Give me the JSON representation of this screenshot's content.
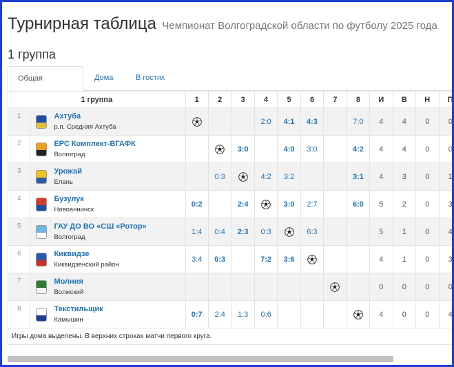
{
  "header": {
    "title": "Турнирная таблица",
    "subtitle": "Чемпионат Волгоградской области по футболу 2025 года"
  },
  "group_heading": "1 группа",
  "tabs": [
    {
      "label": "Общая таблица",
      "active": true
    },
    {
      "label": "Дома",
      "active": false
    },
    {
      "label": "В гостях",
      "active": false
    }
  ],
  "columns": {
    "group": "1 группа",
    "matches": [
      "1",
      "2",
      "3",
      "4",
      "5",
      "6",
      "7",
      "8"
    ],
    "stats": [
      "И",
      "В",
      "Н",
      "П"
    ]
  },
  "rows": [
    {
      "pos": "1",
      "name": "Ахтуба",
      "city": "р.п. Средняя Ахтуба",
      "logo_colors": [
        "#1d4fa8",
        "#e0c040"
      ],
      "results": [
        "ball",
        "",
        "",
        "2:0",
        "4:1",
        "4:3",
        "",
        "7:0"
      ],
      "home": [
        false,
        false,
        false,
        false,
        true,
        true,
        false,
        false
      ],
      "stats": [
        "4",
        "4",
        "0",
        "0"
      ]
    },
    {
      "pos": "2",
      "name": "ЕРС Комплект-ВГАФК",
      "city": "Волгоград",
      "logo_colors": [
        "#f0a020",
        "#222222"
      ],
      "results": [
        "",
        "ball",
        "3:0",
        "",
        "4:0",
        "3:0",
        "",
        "4:2"
      ],
      "home": [
        false,
        false,
        true,
        false,
        true,
        false,
        false,
        true
      ],
      "stats": [
        "4",
        "4",
        "0",
        "0"
      ]
    },
    {
      "pos": "3",
      "name": "Урожай",
      "city": "Елань",
      "logo_colors": [
        "#f3c41b",
        "#2a5db0"
      ],
      "results": [
        "",
        "0:3",
        "ball",
        "4:2",
        "3:2",
        "",
        "",
        "3:1"
      ],
      "home": [
        false,
        false,
        false,
        false,
        false,
        false,
        false,
        true
      ],
      "stats": [
        "4",
        "3",
        "0",
        "1"
      ]
    },
    {
      "pos": "4",
      "name": "Бузулук",
      "city": "Новоаннинск",
      "logo_colors": [
        "#d63a2f",
        "#1f4fa0"
      ],
      "results": [
        "0:2",
        "",
        "2:4",
        "ball",
        "3:0",
        "2:7",
        "",
        "6:0"
      ],
      "home": [
        true,
        false,
        true,
        false,
        true,
        false,
        false,
        true
      ],
      "stats": [
        "5",
        "2",
        "0",
        "3"
      ]
    },
    {
      "pos": "5",
      "name": "ГАУ ДО ВО «СШ «Ротор»",
      "city": "Волгоград",
      "logo_colors": [
        "#6fb7e6",
        "#ffffff"
      ],
      "results": [
        "1:4",
        "0:4",
        "2:3",
        "0:3",
        "ball",
        "6:3",
        "",
        ""
      ],
      "home": [
        false,
        false,
        true,
        false,
        false,
        false,
        false,
        false
      ],
      "stats": [
        "5",
        "1",
        "0",
        "4"
      ]
    },
    {
      "pos": "6",
      "name": "Киквидзе",
      "city": "Киквидзенский район",
      "logo_colors": [
        "#2b58b0",
        "#c9302c"
      ],
      "results": [
        "3:4",
        "0:3",
        "",
        "7:2",
        "3:6",
        "ball",
        "",
        ""
      ],
      "home": [
        false,
        true,
        false,
        true,
        true,
        false,
        false,
        false
      ],
      "stats": [
        "4",
        "1",
        "0",
        "3"
      ]
    },
    {
      "pos": "7",
      "name": "Молния",
      "city": "Волжский",
      "logo_colors": [
        "#2e7d32",
        "#f5f5f5"
      ],
      "results": [
        "",
        "",
        "",
        "",
        "",
        "",
        "ball",
        ""
      ],
      "home": [
        false,
        false,
        false,
        false,
        false,
        false,
        false,
        false
      ],
      "stats": [
        "0",
        "0",
        "0",
        "0"
      ]
    },
    {
      "pos": "8",
      "name": "Текстильщик",
      "city": "Камышин",
      "logo_colors": [
        "#ffffff",
        "#1d3f8f"
      ],
      "results": [
        "0:7",
        "2:4",
        "1:3",
        "0:6",
        "",
        "",
        "",
        "ball"
      ],
      "home": [
        true,
        false,
        false,
        false,
        false,
        false,
        false,
        false
      ],
      "stats": [
        "4",
        "0",
        "0",
        "4"
      ]
    }
  ],
  "note": "Игры дома выделены. В верхних строках матчи первого круга.",
  "colors": {
    "link": "#1f73b7",
    "frame": "#1f3fd1",
    "stripe": "#f2f2f2"
  }
}
